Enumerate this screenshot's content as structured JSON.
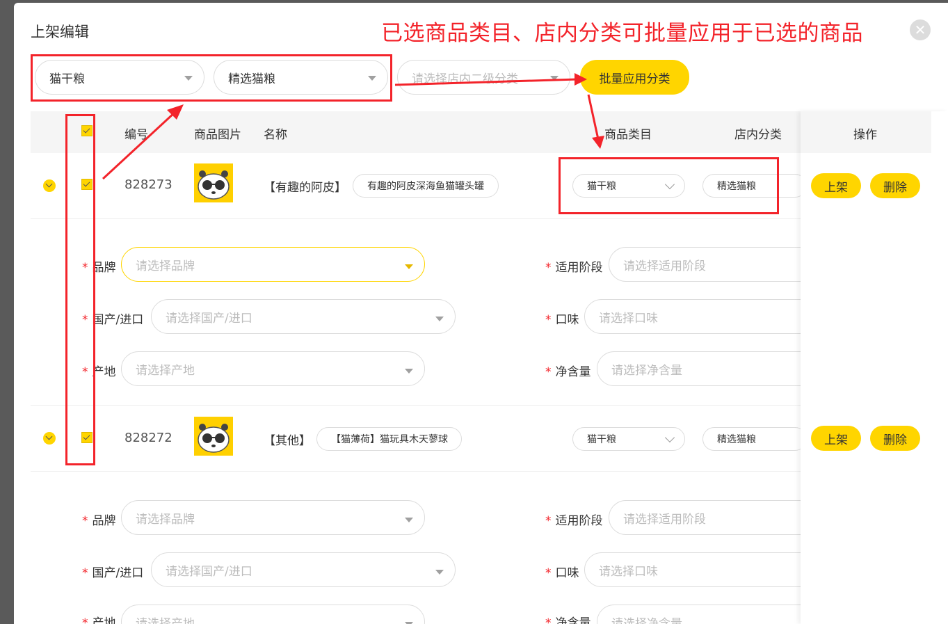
{
  "dialog": {
    "title": "上架编辑",
    "annotation": "已选商品类目、店内分类可批量应用于已选的商品",
    "close_glyph": "✕"
  },
  "batch": {
    "category_value": "猫干粮",
    "store_category_value": "精选猫粮",
    "sub_category_placeholder": "请选择店内二级分类",
    "apply_button": "批量应用分类"
  },
  "table": {
    "headers": {
      "id": "编号",
      "image": "商品图片",
      "name": "名称",
      "category": "商品类目",
      "store_category": "店内分类",
      "actions": "操作"
    }
  },
  "rows": [
    {
      "id": "828273",
      "brand_tag": "【有趣的阿皮】",
      "name_value": "有趣的阿皮深海鱼猫罐头罐",
      "category": "猫干粮",
      "store_category": "精选猫粮",
      "list_button": "上架",
      "delete_button": "删除",
      "fields": {
        "brand_label": "品牌",
        "brand_placeholder": "请选择品牌",
        "origin_type_label": "国产/进口",
        "origin_type_placeholder": "请选择国产/进口",
        "origin_label": "产地",
        "origin_placeholder": "请选择产地",
        "stage_label": "适用阶段",
        "stage_placeholder": "请选择适用阶段",
        "flavor_label": "口味",
        "flavor_placeholder": "请选择口味",
        "net_label": "净含量",
        "net_placeholder": "请选择净含量"
      }
    },
    {
      "id": "828272",
      "brand_tag": "【其他】",
      "name_value": "【猫薄荷】猫玩具木天蓼球",
      "category": "猫干粮",
      "store_category": "精选猫粮",
      "list_button": "上架",
      "delete_button": "删除",
      "fields": {
        "brand_label": "品牌",
        "brand_placeholder": "请选择品牌",
        "origin_type_label": "国产/进口",
        "origin_type_placeholder": "请选择国产/进口",
        "origin_label": "产地",
        "origin_placeholder": "请选择产地",
        "stage_label": "适用阶段",
        "stage_placeholder": "请选择适用阶段",
        "flavor_label": "口味",
        "flavor_placeholder": "请选择口味",
        "net_label": "净含量",
        "net_placeholder": "请选择净含量"
      }
    }
  ],
  "required_mark": "*",
  "colors": {
    "accent": "#ffd500",
    "annotation_red": "#f3232a",
    "required_red": "#f3232a",
    "placeholder": "#bcbcbc"
  }
}
